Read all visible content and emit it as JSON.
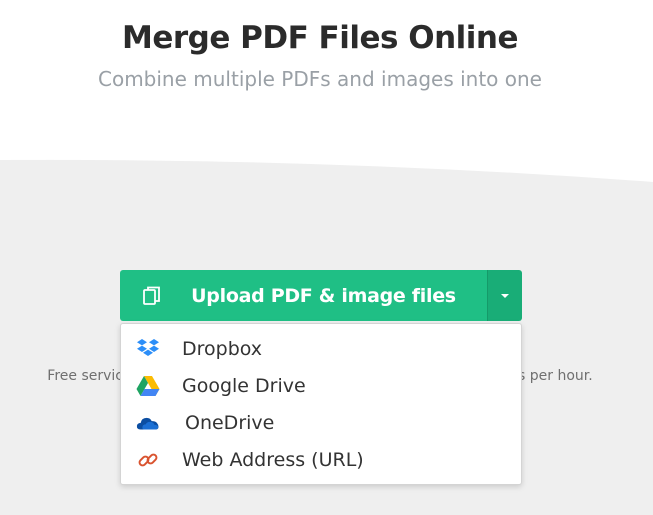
{
  "header": {
    "title": "Merge PDF Files Online",
    "subtitle": "Combine multiple PDFs and images into one"
  },
  "upload": {
    "label": "Upload PDF & image files",
    "color": "#1fbf85",
    "toggle_color": "#19ad77"
  },
  "note": {
    "left_text": "Free servic",
    "right_text": "s per hour."
  },
  "dropdown": {
    "items": [
      {
        "label": "Dropbox",
        "icon": "dropbox-icon",
        "color": "#2c8ef8"
      },
      {
        "label": "Google Drive",
        "icon": "google-drive-icon",
        "color": "#1fa463"
      },
      {
        "label": "OneDrive",
        "icon": "onedrive-icon",
        "color": "#0b4ea2"
      },
      {
        "label": "Web Address (URL)",
        "icon": "link-icon",
        "color": "#d9532f"
      }
    ]
  }
}
